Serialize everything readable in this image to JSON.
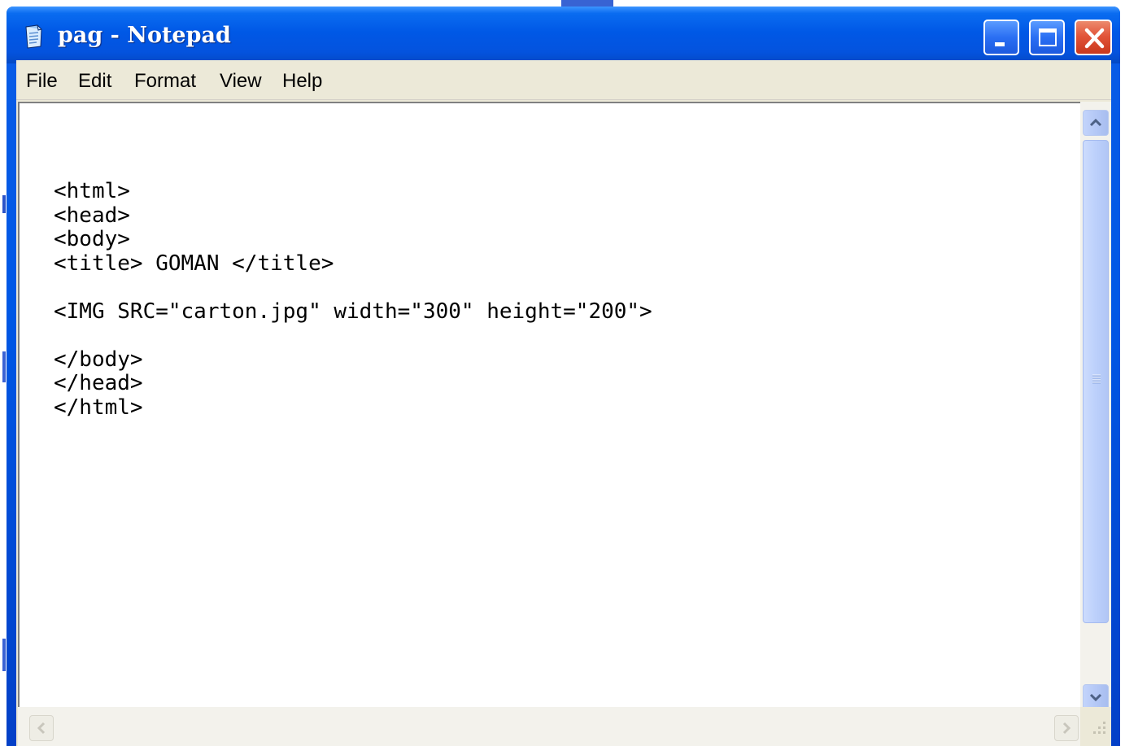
{
  "window": {
    "title": "pag - Notepad"
  },
  "menu": {
    "file": "File",
    "edit": "Edit",
    "format": "Format",
    "view": "View",
    "help": "Help"
  },
  "editor": {
    "content": "<html>\n<head>\n<body>\n<title> GOMAN </title>\n\n<IMG SRC=\"carton.jpg\" width=\"300\" height=\"200\">\n\n</body>\n</head>\n</html>"
  },
  "icons": {
    "app": "notepad-icon",
    "minimize": "minimize-icon",
    "maximize": "maximize-icon",
    "close": "close-icon",
    "scroll_up": "chevron-up-icon",
    "scroll_down": "chevron-down-icon",
    "scroll_left": "chevron-left-icon",
    "scroll_right": "chevron-right-icon"
  },
  "colors": {
    "titlebar": "#0058e6",
    "close_button": "#e2553a",
    "menubar": "#ece9d8",
    "scrollbar": "#bcd0fb"
  }
}
